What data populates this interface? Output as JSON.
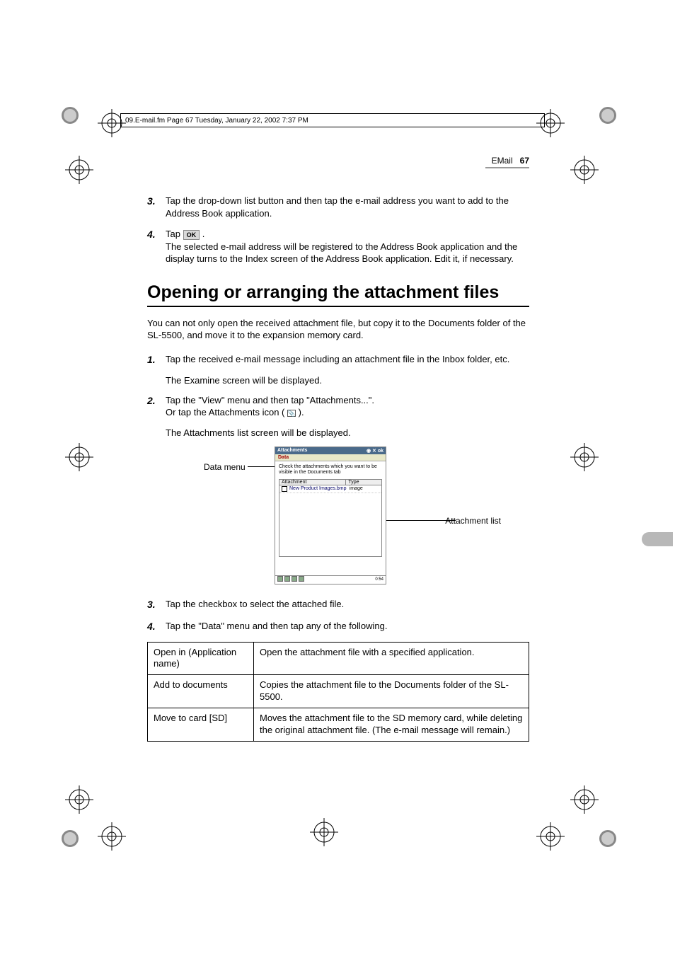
{
  "frame_header": "09.E-mail.fm  Page 67  Tuesday, January 22, 2002  7:37 PM",
  "running_head": {
    "section": "EMail",
    "page": "67"
  },
  "pre_steps": [
    {
      "n": "3.",
      "text": "Tap the drop-down list button and then tap the e-mail address you want to add to the Address Book application."
    },
    {
      "n": "4.",
      "lead": "Tap ",
      "button": "OK",
      "tail": " .",
      "cont": "The selected e-mail address will be registered to the Address Book application and the display turns to the Index screen of the Address Book application. Edit it, if necessary."
    }
  ],
  "heading": "Opening or arranging the attachment files",
  "intro": "You can not only open the received attachment file, but copy it to the Documents folder of the SL-5500, and move it to the expansion memory card.",
  "steps": [
    {
      "n": "1.",
      "text": "Tap the received e-mail message including an attachment file in the Inbox folder, etc.",
      "after": "The Examine screen will be displayed."
    },
    {
      "n": "2.",
      "text": "Tap the \"View\" menu and then tap \"Attachments...\".",
      "line2a": "Or tap the Attachments icon (",
      "line2b": ").",
      "after": "The Attachments list screen will be displayed."
    }
  ],
  "callouts": {
    "left": "Data menu",
    "right": "Attachment list"
  },
  "pda": {
    "title": "Attachments",
    "menu": "Data",
    "instr": "Check the attachments which you want to be visible in the Documents tab",
    "col1": "Attachment",
    "col2": "Type",
    "row_file": "New Product Images.bmp",
    "row_type": "image",
    "clock": "0:54"
  },
  "post_steps": [
    {
      "n": "3.",
      "text": "Tap the checkbox to select the attached file."
    },
    {
      "n": "4.",
      "text": "Tap the \"Data\" menu and then tap any of the following."
    }
  ],
  "table": [
    {
      "k": "Open in (Application name)",
      "v": "Open the attachment file with a specified application."
    },
    {
      "k": "Add to documents",
      "v": "Copies the attachment file to the Documents folder of the SL-5500."
    },
    {
      "k": "Move to card [SD]",
      "v": "Moves the attachment file to the SD memory card, while deleting the original attachment file. (The e-mail message will remain.)"
    }
  ]
}
